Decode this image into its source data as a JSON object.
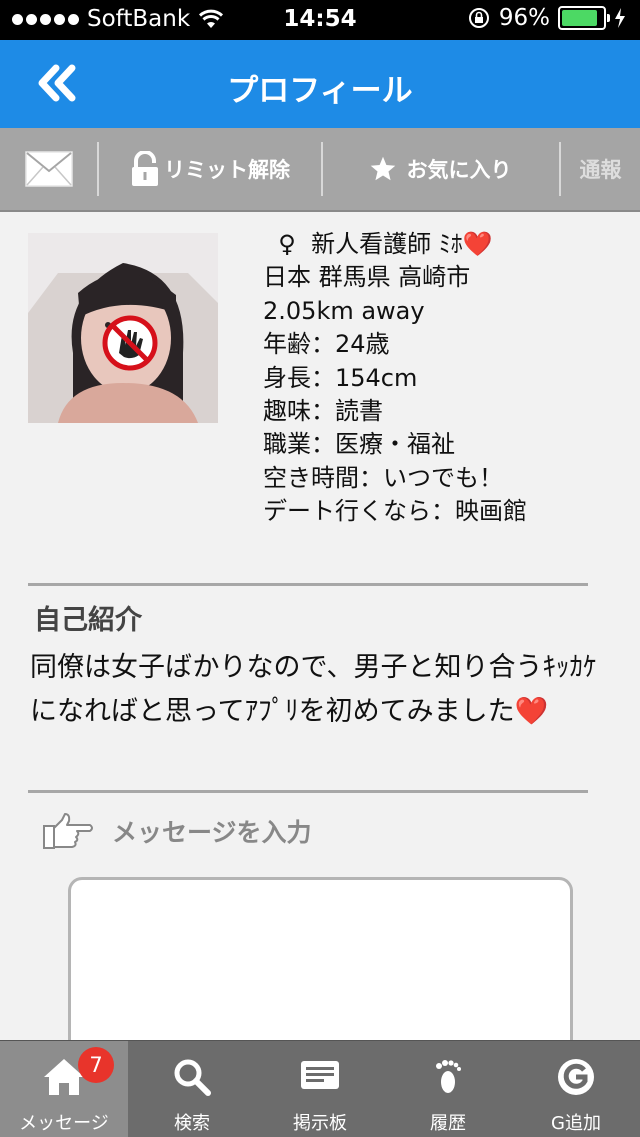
{
  "status_bar": {
    "carrier": "SoftBank",
    "time": "14:54",
    "battery": "96%",
    "battery_level": 0.96
  },
  "nav": {
    "title": "プロフィール"
  },
  "actions": {
    "limit_release": "リミット解除",
    "favorite": "お気に入り",
    "report": "通報"
  },
  "profile": {
    "gender_symbol": "♀",
    "name": "新人看護師 ﾐﾎ",
    "heart": "❤️",
    "location": "日本 群馬県 高崎市",
    "distance": "2.05km away",
    "age": "年齢：24歳",
    "height": "身長：154cm",
    "hobby": "趣味：読書",
    "job": "職業：医療・福祉",
    "free_time": "空き時間：いつでも！",
    "date_spot": "デート行くなら：映画館"
  },
  "intro": {
    "title": "自己紹介",
    "text": " 同僚は女子ばかりなので、男子と知り合うｷｯｶｹになればと思ってｱﾌﾟﾘを初めてみました",
    "heart": "❤️"
  },
  "message": {
    "label": "メッセージを入力"
  },
  "tabs": [
    {
      "label": "メッセージ",
      "icon": "home-icon",
      "badge": "7"
    },
    {
      "label": "検索",
      "icon": "search-icon"
    },
    {
      "label": "掲示板",
      "icon": "board-icon"
    },
    {
      "label": "履歴",
      "icon": "footprint-icon"
    },
    {
      "label": "G追加",
      "icon": "g-icon"
    }
  ],
  "colors": {
    "nav_blue": "#1e8be6",
    "action_bar": "#a5a5a5",
    "tab_bar": "#6c6c6c",
    "tab_active": "#8d8d8d",
    "badge": "#e8342b",
    "battery": "#4cd964"
  }
}
